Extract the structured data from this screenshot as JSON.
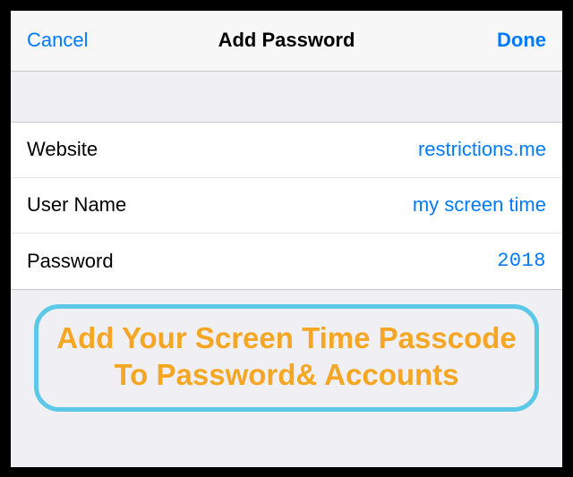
{
  "navbar": {
    "cancel": "Cancel",
    "title": "Add Password",
    "done": "Done"
  },
  "form": {
    "website": {
      "label": "Website",
      "value": "restrictions.me"
    },
    "username": {
      "label": "User Name",
      "value": "my screen time"
    },
    "password": {
      "label": "Password",
      "value": "2018"
    }
  },
  "callout": {
    "text": "Add Your Screen Time Passcode To Password& Accounts"
  },
  "colors": {
    "accent": "#007aff",
    "callout_border": "#5ac8e6",
    "callout_text": "#f5a623"
  }
}
